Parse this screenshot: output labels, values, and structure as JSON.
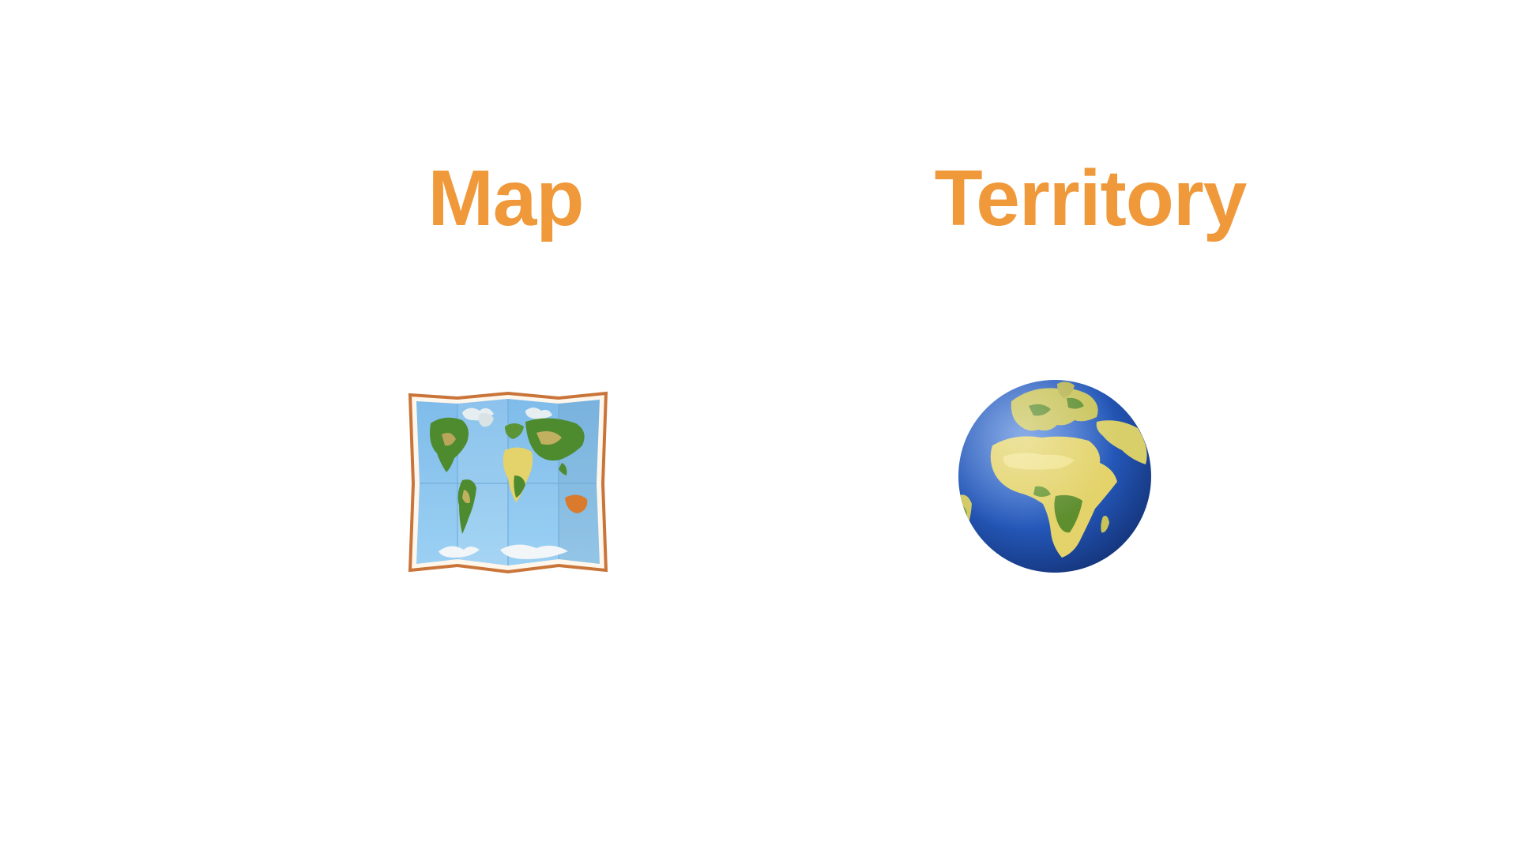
{
  "colors": {
    "heading": "#F0993B",
    "background": "#FFFFFF",
    "map_frame": "#C9753A",
    "ocean_light": "#8FC6EE",
    "ocean_globe": "#2457B8",
    "land_green": "#4E8A2E",
    "land_yellow": "#E3D36A"
  },
  "left_panel": {
    "title": "Map",
    "icon": "world-map-icon"
  },
  "right_panel": {
    "title": "Territory",
    "icon": "globe-europe-africa-icon"
  }
}
